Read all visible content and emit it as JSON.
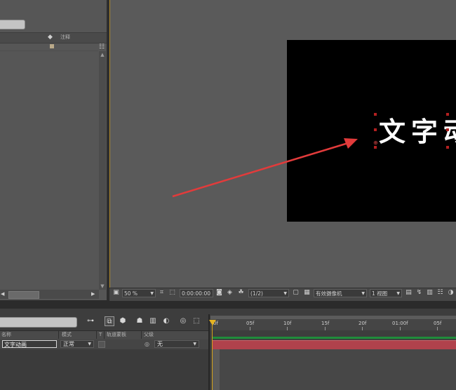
{
  "project": {
    "columns": {
      "comment": "注释"
    }
  },
  "composition": {
    "text": "文字动",
    "background": "#000000"
  },
  "viewer_toolbar": {
    "zoom": "50 %",
    "timecode": "0:00:00:00",
    "resolution": "(1/2)",
    "camera": "有效摄像机",
    "view": "1 视图"
  },
  "timeline": {
    "columns": {
      "name": "名称",
      "mode": "模式",
      "t": "T",
      "trkmat": "轨道蒙板",
      "parent": "父级"
    },
    "layer": {
      "name": "文字动画",
      "mode": "正常",
      "parent": "无"
    },
    "ruler": [
      "0f",
      "05f",
      "10f",
      "15f",
      "20f",
      "01:00f",
      "05f"
    ]
  },
  "colors": {
    "accent": "#e6b422",
    "layer_bar": "#b0424c",
    "annotation_arrow": "#e23b3b",
    "label_swatch": "#b9a989"
  }
}
